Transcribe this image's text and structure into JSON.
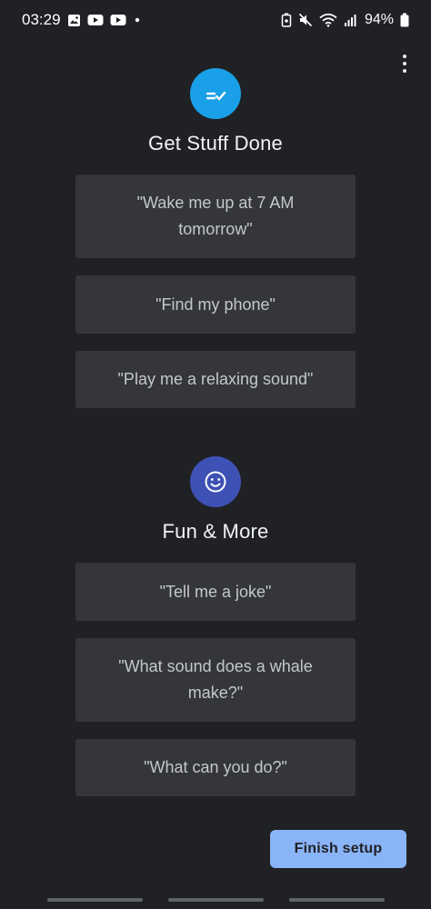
{
  "status_bar": {
    "time": "03:29",
    "battery": "94%",
    "left_icons": [
      "gallery-icon",
      "youtube-icon",
      "youtube-icon",
      "notification-dot-icon"
    ],
    "right_icons": [
      "battery-saver-icon",
      "mute-icon",
      "wifi-icon",
      "signal-icon",
      "battery-icon"
    ]
  },
  "sections": [
    {
      "title": "Get Stuff Done",
      "icon": "tasks-check-icon",
      "icon_color": "#1aa0e8",
      "suggestions": [
        "\"Wake me up at 7 AM tomorrow\"",
        "\"Find my phone\"",
        "\"Play me a relaxing sound\""
      ]
    },
    {
      "title": "Fun & More",
      "icon": "smiley-icon",
      "icon_color": "#3e51b5",
      "suggestions": [
        "\"Tell me a joke\"",
        "\"What sound does a whale make?\"",
        "\"What can you do?\""
      ]
    }
  ],
  "footer": {
    "finish_label": "Finish setup",
    "finish_color": "#8ab4f8"
  },
  "colors": {
    "background": "#202124",
    "card": "#35363a"
  }
}
